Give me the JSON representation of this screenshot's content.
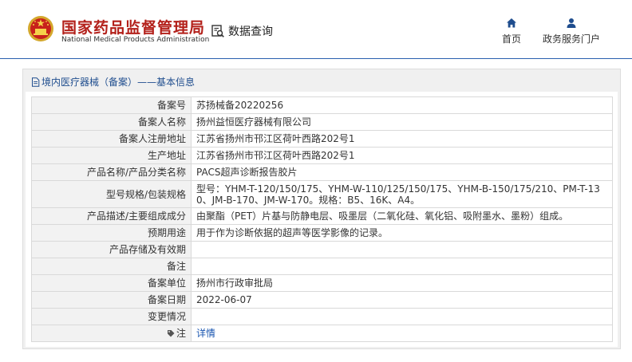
{
  "site": {
    "name_cn": "国家药品监督管理局",
    "name_en": "National Medical Products Administration",
    "query_label": "数据查询",
    "icons": {
      "emblem": "national-emblem-icon",
      "query": "document-search-icon"
    },
    "colors": {
      "brand": "#b3201a",
      "accent": "#1f4d8e",
      "link": "#1a56b0"
    }
  },
  "nav": {
    "home": {
      "label": "首页",
      "icon": "home-icon"
    },
    "gov": {
      "label": "政务服务门户",
      "icon": "user-icon"
    }
  },
  "breadcrumb": {
    "text": "境内医疗器械（备案）——基本信息",
    "icon": "document-icon"
  },
  "record": {
    "rows": [
      {
        "key": "备案号",
        "value": "苏扬械备20220256"
      },
      {
        "key": "备案人名称",
        "value": "扬州益恒医疗器械有限公司"
      },
      {
        "key": "备案人注册地址",
        "value": "江苏省扬州市邗江区荷叶西路202号1"
      },
      {
        "key": "生产地址",
        "value": "江苏省扬州市邗江区荷叶西路202号1"
      },
      {
        "key": "产品名称/产品分类名称",
        "value": "PACS超声诊断报告胶片"
      },
      {
        "key": "型号规格/包装规格",
        "value": "型号：YHM-T-120/150/175、YHM-W-110/125/150/175、YHM-B-150/175/210、PM-T-130、JM-B-170、JM-W-170。规格：B5、16K、A4。"
      },
      {
        "key": "产品描述/主要组成成分",
        "value": "由聚酯（PET）片基与防静电层、吸墨层（二氧化硅、氧化铝、吸附墨水、墨粉）组成。"
      },
      {
        "key": "预期用途",
        "value": "用于作为诊断依据的超声等医学影像的记录。"
      },
      {
        "key": "产品存储及有效期",
        "value": ""
      },
      {
        "key": "备注",
        "value": ""
      },
      {
        "key": "备案单位",
        "value": "扬州市行政审批局"
      },
      {
        "key": "备案日期",
        "value": "2022-06-07"
      },
      {
        "key": "变更情况",
        "value": ""
      },
      {
        "key": "注",
        "value": "详情",
        "icon": "tag-icon"
      }
    ]
  }
}
